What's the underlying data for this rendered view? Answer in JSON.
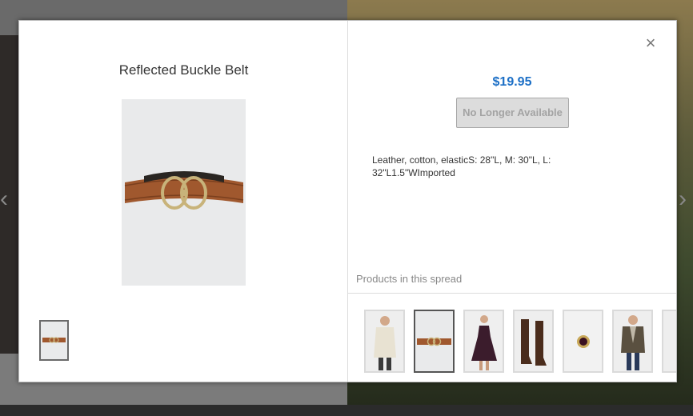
{
  "product": {
    "title": "Reflected Buckle Belt",
    "price": "$19.95",
    "status_button": "No Longer Available",
    "description": "Leather, cotton, elasticS: 28\"L, M: 30\"L, L: 32\"L1.5\"WImported"
  },
  "spread": {
    "label": "Products in this spread",
    "items": [
      {
        "icon": "cardigan-icon",
        "selected": false
      },
      {
        "icon": "belt-icon",
        "selected": true
      },
      {
        "icon": "dress-icon",
        "selected": false
      },
      {
        "icon": "boots-icon",
        "selected": false
      },
      {
        "icon": "ring-icon",
        "selected": false
      },
      {
        "icon": "blazer-icon",
        "selected": false
      },
      {
        "icon": "partial-item-icon",
        "selected": false
      }
    ]
  },
  "close_icon": "close-icon",
  "colors": {
    "price": "#1c6fc6",
    "selected_border": "#555555"
  }
}
